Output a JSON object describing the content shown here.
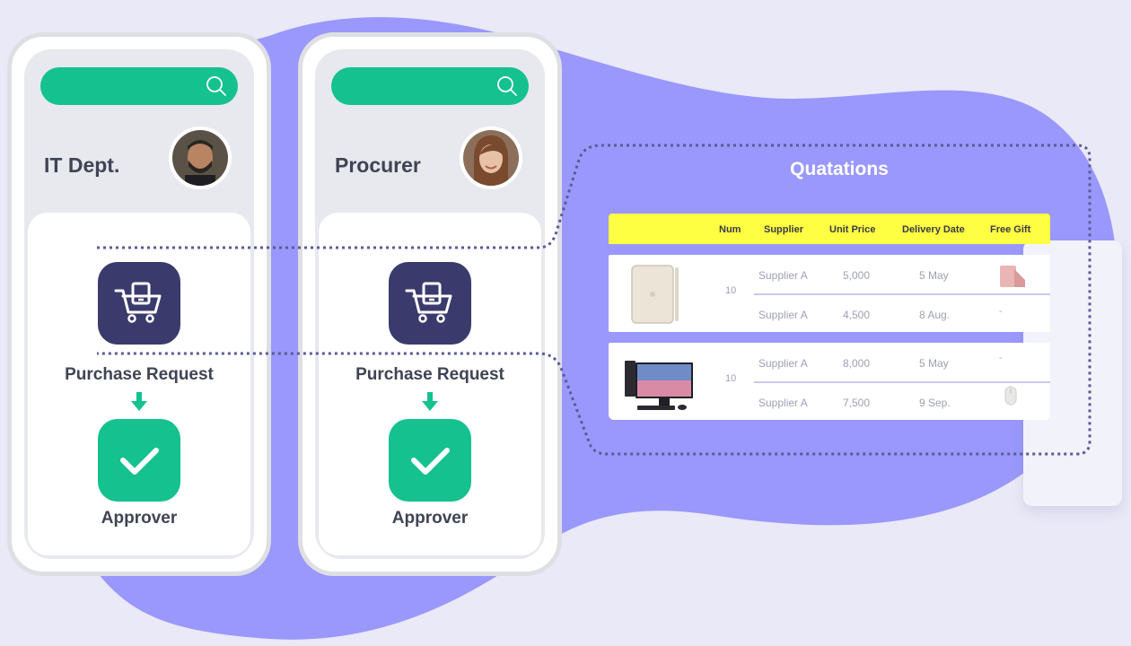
{
  "colors": {
    "background": "#e9e9f7",
    "blob": "#9a98fc",
    "accent_green": "#14c18f",
    "tile_navy": "#3b3a6c",
    "header_yellow": "#fefe42",
    "text_dark": "#3f4354",
    "text_muted": "#9ea0b4",
    "dotted_line": "#5b5a96"
  },
  "phones": [
    {
      "role": "IT Dept.",
      "avatar": "man-avatar",
      "request_label": "Purchase Request",
      "approver_label": "Approver"
    },
    {
      "role": "Procurer",
      "avatar": "woman-avatar",
      "request_label": "Purchase Request",
      "approver_label": "Approver"
    }
  ],
  "quotations": {
    "title": "Quatations",
    "headers": [
      "Num",
      "Supplier",
      "Unit Price",
      "Delivery Date",
      "Free Gift"
    ],
    "groups": [
      {
        "product_icon": "tablet-icon",
        "num": "10",
        "rows": [
          {
            "supplier": "Supplier A",
            "unit_price": "5,000",
            "delivery": "5 May",
            "gift": "tablet-case-icon"
          },
          {
            "supplier": "Supplier A",
            "unit_price": "4,500",
            "delivery": "8 Aug.",
            "gift": "-"
          }
        ]
      },
      {
        "product_icon": "desktop-computer-icon",
        "num": "10",
        "rows": [
          {
            "supplier": "Supplier A",
            "unit_price": "8,000",
            "delivery": "5 May",
            "gift": "-"
          },
          {
            "supplier": "Supplier A",
            "unit_price": "7,500",
            "delivery": "9 Sep.",
            "gift": "mouse-icon"
          }
        ]
      }
    ]
  }
}
